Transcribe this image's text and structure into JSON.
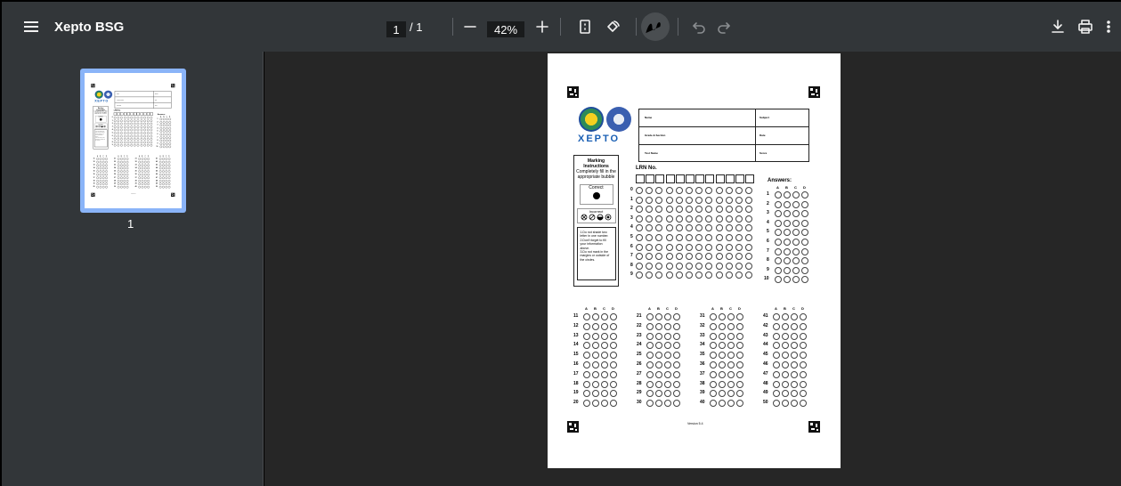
{
  "toolbar": {
    "title": "Xepto BSG",
    "current_page": "1",
    "page_total": "/ 1",
    "zoom": "42%"
  },
  "sidebar": {
    "thumbnail_label": "1"
  },
  "sheet": {
    "header_fields": [
      {
        "left": "Name",
        "right": "Subject"
      },
      {
        "left": "Grade & Section",
        "right": "Date"
      },
      {
        "left": "Test Name",
        "right": "Score"
      }
    ],
    "logo_text": "XEPTO",
    "instructions_title": "Marking Instructions",
    "instructions_desc": "Completely fill in the appropriate bubble",
    "correct_label": "Correct",
    "incorrect_label": "Incorrect",
    "notes": [
      "1.Do not shade two letter in one number.",
      "2.Don't forget to fill your information above.",
      "3.Do not mark in the margins or outside of the circles."
    ],
    "lrn_title": "LRN No.",
    "answers_title": "Answers:",
    "choices": [
      "A",
      "B",
      "C",
      "D"
    ],
    "digits": [
      "0",
      "1",
      "2",
      "3",
      "4",
      "5",
      "6",
      "7",
      "8",
      "9"
    ],
    "top_answers": [
      "1",
      "2",
      "3",
      "4",
      "5",
      "6",
      "7",
      "8",
      "9",
      "10"
    ],
    "bottom_answers": [
      [
        "11",
        "12",
        "13",
        "14",
        "15",
        "16",
        "17",
        "18",
        "19",
        "20"
      ],
      [
        "21",
        "22",
        "23",
        "24",
        "25",
        "26",
        "27",
        "28",
        "29",
        "30"
      ],
      [
        "31",
        "32",
        "33",
        "34",
        "35",
        "36",
        "37",
        "38",
        "39",
        "40"
      ],
      [
        "41",
        "42",
        "43",
        "44",
        "45",
        "46",
        "47",
        "48",
        "49",
        "50"
      ]
    ],
    "version": "Version 5.4"
  },
  "colors": {
    "toolbar_bg": "#323639",
    "viewer_bg": "#262626",
    "thumb_highlight": "#8ab4f8"
  }
}
